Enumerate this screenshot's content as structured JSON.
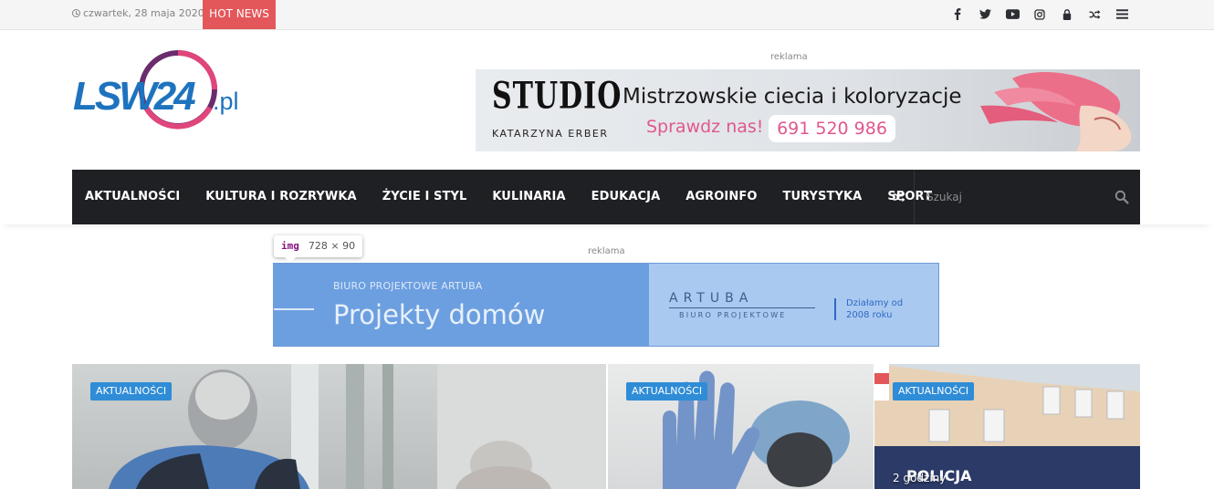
{
  "topbar": {
    "date": "czwartek, 28 maja 2020",
    "hot_news": "HOT NEWS",
    "social_icons": [
      "facebook-icon",
      "twitter-icon",
      "youtube-icon",
      "instagram-icon",
      "lock-icon",
      "shuffle-icon",
      "menu-icon"
    ]
  },
  "header": {
    "logo_text_main": "LSW24",
    "logo_text_suffix": ".pl",
    "ad_label": "reklama",
    "ad": {
      "brand": "STUDIO",
      "owner": "KATARZYNA ERBER",
      "tagline": "Mistrzowskie ciecia i koloryzacje",
      "cta": "Sprawdz nas!",
      "phone": "691 520 986"
    }
  },
  "nav": {
    "items": [
      "AKTUALNOŚCI",
      "KULTURA I ROZRYWKA",
      "ŻYCIE I STYL",
      "KULINARIA",
      "EDUKACJA",
      "AGROINFO",
      "TURYSTYKA",
      "SPORT"
    ],
    "search_placeholder": "Szukaj"
  },
  "devtools_tooltip": {
    "tag": "img",
    "dimensions": "728 × 90"
  },
  "ad2": {
    "label": "reklama",
    "small": "BIURO PROJEKTOWE ARTUBA",
    "headline": "Projekty domów",
    "brand": "ARTUBA",
    "brand_sub": "BIURO PROJEKTOWE",
    "since_line1": "Działamy od",
    "since_line2": "2008 roku"
  },
  "news": [
    {
      "category": "AKTUALNOŚCI",
      "time": ""
    },
    {
      "category": "AKTUALNOŚCI",
      "time": ""
    },
    {
      "category": "AKTUALNOŚCI",
      "time": "2 godziny"
    }
  ],
  "colors": {
    "hot_news": "#e3575b",
    "nav_bg": "#1f2024",
    "badge": "#2f8cd6",
    "logo_blue": "#1e73be",
    "logo_purple": "#6b2c6e",
    "logo_pink": "#e0457b"
  }
}
